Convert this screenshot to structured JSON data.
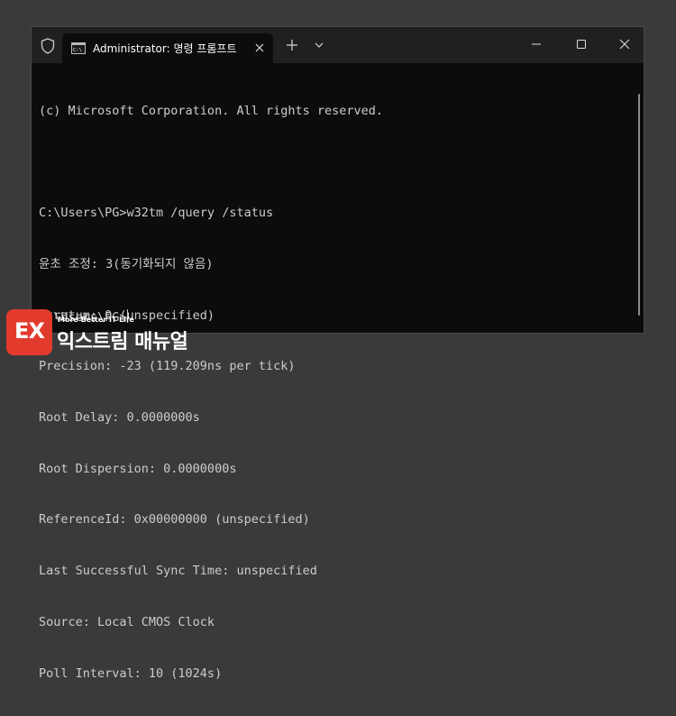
{
  "window": {
    "tab_title": "Administrator: 명령 프롬프트"
  },
  "console": {
    "lines": [
      "(c) Microsoft Corporation. All rights reserved.",
      "",
      "C:\\Users\\PG>w32tm /query /status",
      "윤초 조정: 3(동기화되지 않음)",
      "Stratum: 0 (unspecified)",
      "Precision: -23 (119.209ns per tick)",
      "Root Delay: 0.0000000s",
      "Root Dispersion: 0.0000000s",
      "ReferenceId: 0x00000000 (unspecified)",
      "Last Successful Sync Time: unspecified",
      "Source: Local CMOS Clock",
      "Poll Interval: 10 (1024s)"
    ],
    "prompt": "C:\\Users\\PG>"
  },
  "watermark": {
    "logo": "EX",
    "tagline": "More Better IT Life",
    "name": "익스트림 매뉴얼"
  },
  "colors": {
    "console_bg": "#0c0c0c",
    "titlebar_bg": "#202020",
    "text": "#cccccc",
    "brand_red": "#e23b2e"
  }
}
